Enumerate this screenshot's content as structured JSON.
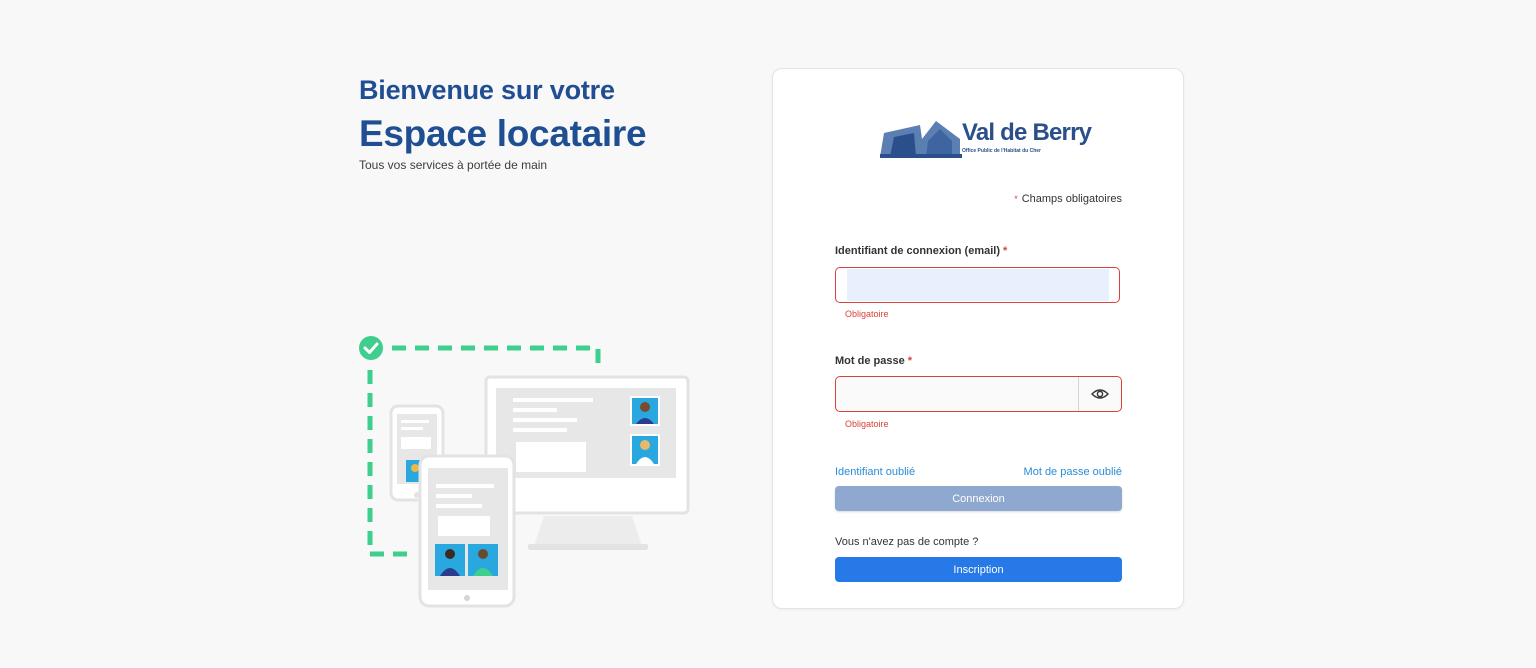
{
  "intro": {
    "line1": "Bienvenue sur votre",
    "line2": "Espace locataire",
    "subtitle": "Tous vos services à portée de main"
  },
  "brand": {
    "name": "Val de Berry",
    "tagline": "Office Public de l'Habitat du Cher",
    "primary_color": "#1f4e92",
    "accent_green": "#86bc24"
  },
  "form": {
    "required_note": "Champs obligatoires",
    "required_marker": "*",
    "email_label": "Identifiant de connexion (email)",
    "email_value": "",
    "email_error": "Obligatoire",
    "password_label": "Mot de passe",
    "password_value": "",
    "password_error": "Obligatoire",
    "show_password_icon": "eye-icon",
    "forgot_id": "Identifiant oublié",
    "forgot_password": "Mot de passe oublié",
    "login_button": "Connexion",
    "no_account_text": "Vous n'avez pas de compte ?",
    "signup_button": "Inscription"
  },
  "colors": {
    "error": "#d9413a",
    "link": "#2a8cd6",
    "login_button": "#8fa8cf",
    "signup_button": "#2679e6",
    "dashed_path": "#3ecf8e"
  }
}
